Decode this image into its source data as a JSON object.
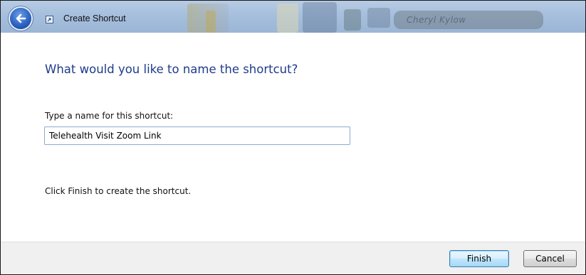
{
  "window": {
    "title": "Create Shortcut",
    "background_blur_text": "Cheryl Kylow"
  },
  "titlebar": {
    "back_icon": "back-arrow-icon",
    "app_icon": "shortcut-icon"
  },
  "main": {
    "heading": "What would you like to name the shortcut?",
    "field_label": "Type a name for this shortcut:",
    "name_value": "Telehealth Visit Zoom Link",
    "hint": "Click Finish to create the shortcut."
  },
  "footer": {
    "finish_label": "Finish",
    "cancel_label": "Cancel"
  },
  "colors": {
    "heading": "#1f3b8c",
    "titlebar": "#a6bfdd",
    "footer": "#f0f0f0",
    "default_button_border": "#3c7fb1"
  }
}
